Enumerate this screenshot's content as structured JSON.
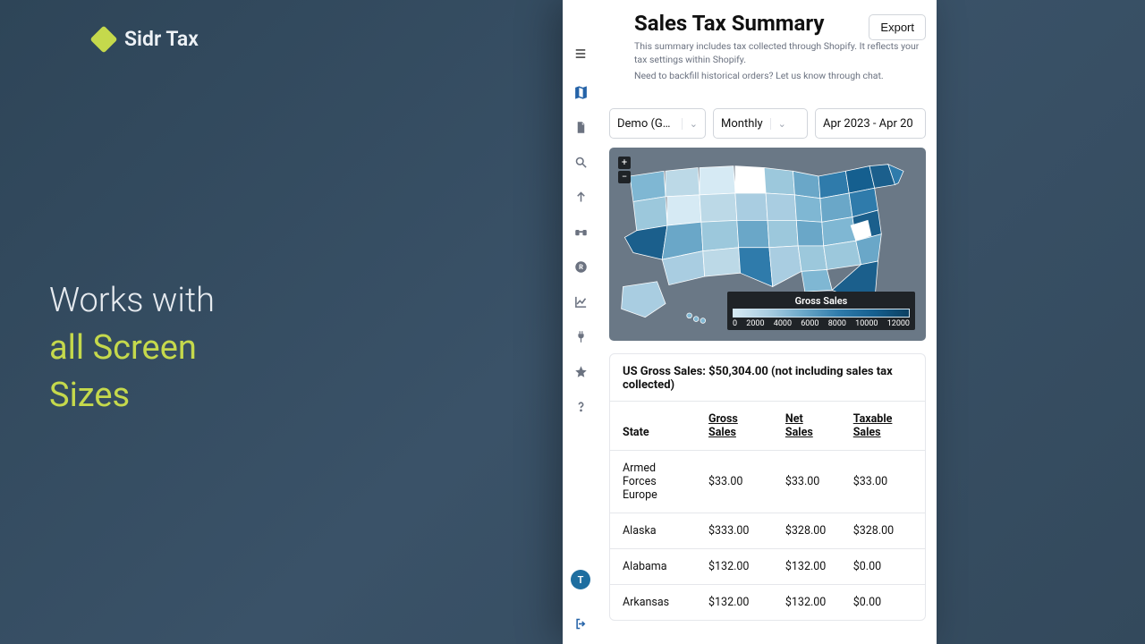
{
  "brand": {
    "name": "Sidr Tax"
  },
  "hero": {
    "line1": "Works with",
    "line2": "all Screen",
    "line3": "Sizes"
  },
  "header": {
    "title": "Sales Tax Summary",
    "subtitle_line1": "This summary includes tax collected through Shopify. It reflects your tax settings within Shopify.",
    "subtitle_line2": "Need to backfill historical orders? Let us know through chat.",
    "export": "Export"
  },
  "sidebar": {
    "avatar_initial": "T"
  },
  "filters": {
    "store": "Demo (GR...",
    "period": "Monthly",
    "daterange": "Apr 2023 - Apr 20"
  },
  "map": {
    "legend_title": "Gross Sales",
    "ticks": [
      "0",
      "2000",
      "4000",
      "6000",
      "8000",
      "10000",
      "12000"
    ]
  },
  "summary": {
    "title": "US Gross Sales: $50,304.00 (not including sales tax collected)",
    "columns": {
      "state": "State",
      "gross": "Gross Sales",
      "net": "Net Sales",
      "taxable": "Taxable Sales"
    },
    "rows": [
      {
        "state": "Armed Forces Europe",
        "gross": "$33.00",
        "net": "$33.00",
        "taxable": "$33.00"
      },
      {
        "state": "Alaska",
        "gross": "$333.00",
        "net": "$328.00",
        "taxable": "$328.00"
      },
      {
        "state": "Alabama",
        "gross": "$132.00",
        "net": "$132.00",
        "taxable": "$0.00"
      },
      {
        "state": "Arkansas",
        "gross": "$132.00",
        "net": "$132.00",
        "taxable": "$0.00"
      }
    ]
  },
  "chart_data": {
    "type": "heatmap",
    "title": "Gross Sales",
    "variable": "Gross Sales",
    "color_scale_ticks": [
      0,
      2000,
      4000,
      6000,
      8000,
      10000,
      12000
    ],
    "note": "Choropleth US map; individual state values not labeled",
    "total": 50304.0
  }
}
